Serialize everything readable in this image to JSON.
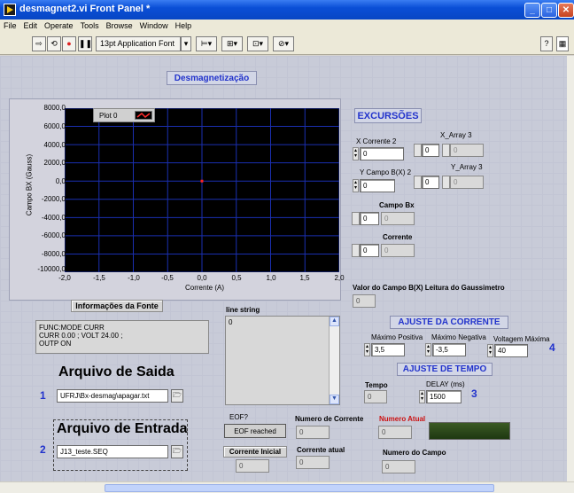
{
  "window": {
    "title": "desmagnet2.vi Front Panel *"
  },
  "menu": [
    "File",
    "Edit",
    "Operate",
    "Tools",
    "Browse",
    "Window",
    "Help"
  ],
  "toolbar": {
    "font": "13pt Application Font"
  },
  "chart": {
    "title": "Desmagnetização",
    "legend": "Plot 0",
    "ylabel": "Campo BX (Gauss)",
    "xlabel": "Corrente (A)",
    "yticks": [
      "8000,0",
      "6000,0",
      "4000,0",
      "2000,0",
      "0,0",
      "-2000,0",
      "-4000,0",
      "-6000,0",
      "-8000,0",
      "-10000,0"
    ],
    "xticks": [
      "-2,0",
      "-1,5",
      "-1,0",
      "-0,5",
      "0,0",
      "0,5",
      "1,0",
      "1,5",
      "2,0"
    ]
  },
  "chart_data": {
    "type": "scatter",
    "x": [
      0.0
    ],
    "y": [
      0.0
    ],
    "series": [
      {
        "name": "Plot 0",
        "x": [
          0.0
        ],
        "y": [
          0.0
        ]
      }
    ],
    "title": "Desmagnetização",
    "xlabel": "Corrente (A)",
    "ylabel": "Campo BX (Gauss)",
    "xlim": [
      -2.0,
      2.0
    ],
    "ylim": [
      -10000.0,
      8000.0
    ],
    "grid": true,
    "colors": {
      "background": "#000000",
      "grid": "#1a2fb0",
      "point": "#ff2020"
    }
  },
  "excursoes": {
    "title": "EXCURSÕES",
    "x_corrente_label": "X Corrente  2",
    "x_corrente_value": "0",
    "x_array_label": "X_Array 3",
    "x_array_index": "0",
    "x_array_value": "0",
    "y_campo_label": "Y Campo B(X) 2",
    "y_campo_value": "0",
    "y_array_label": "Y_Array 3",
    "y_array_index": "0",
    "y_array_value": "0",
    "campo_bx_label": "Campo Bx",
    "campo_bx_index": "0",
    "campo_bx_value": "0",
    "corrente_label": "Corrente",
    "corrente_index": "0",
    "corrente_value": "0"
  },
  "leitura": {
    "label": "Valor do Campo B(X) Leitura do Gaussimetro",
    "value": "0"
  },
  "fonte": {
    "title": "Informações da Fonte",
    "text": "FUNC:MODE CURR\nCURR 0.00 ; VOLT 24.00 ;\nOUTP ON"
  },
  "line_string": {
    "label": "line string",
    "value": "0"
  },
  "ajuste_corrente": {
    "title": "AJUSTE DA CORRENTE",
    "max_pos_label": "Máximo Positiva",
    "max_pos_value": "3,5",
    "max_neg_label": "Máximo Negativa",
    "max_neg_value": "-3,5",
    "volt_label": "Voltagem Máxima",
    "volt_value": "40",
    "badge": "4"
  },
  "ajuste_tempo": {
    "title": "AJUSTE DE TEMPO",
    "tempo_label": "Tempo",
    "tempo_value": "0",
    "delay_label": "DELAY (ms)",
    "delay_value": "1500",
    "badge": "3"
  },
  "saida": {
    "title": "Arquivo de Saida",
    "badge": "1",
    "path": "UFRJ\\Bx-desmag\\apagar.txt"
  },
  "entrada": {
    "title": "Arquivo de Entrada",
    "badge": "2",
    "path": "J13_teste.SEQ"
  },
  "eof": {
    "label": "EOF?",
    "button": "EOF reached"
  },
  "numero_corrente": {
    "label": "Numero de Corrente",
    "value": "0"
  },
  "numero_atual": {
    "label": "Numero Atual",
    "value": "0"
  },
  "corrente_inicial": {
    "label": "Corrente  Inicial",
    "value": "0"
  },
  "corrente_atual": {
    "label": "Corrente atual",
    "value": "0"
  },
  "numero_campo": {
    "label": "Numero do Campo",
    "value": "0"
  }
}
